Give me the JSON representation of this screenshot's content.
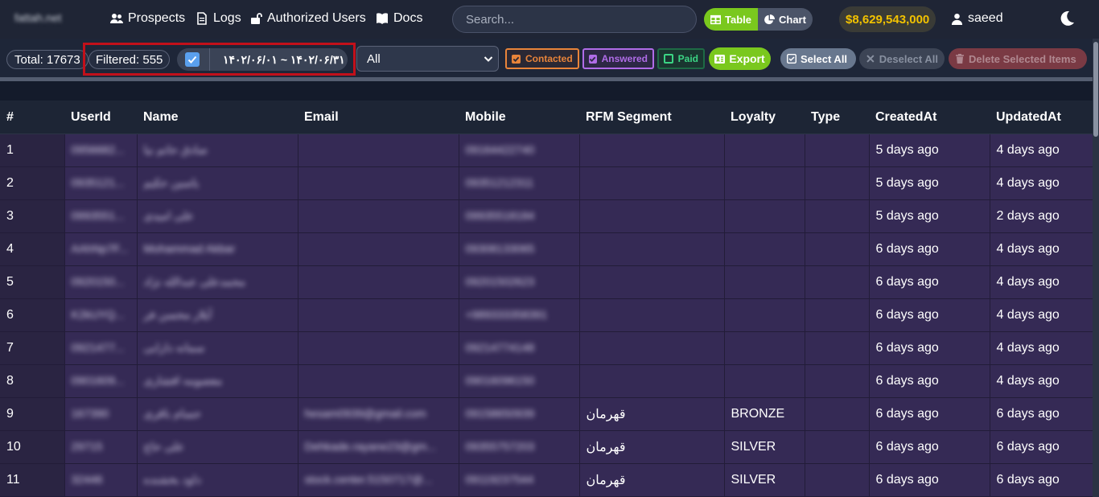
{
  "nav": {
    "brand": "fattah.net",
    "links": [
      {
        "label": "Prospects",
        "icon": "users-icon"
      },
      {
        "label": "Logs",
        "icon": "document-icon"
      },
      {
        "label": "Authorized Users",
        "icon": "unlock-icon"
      },
      {
        "label": "Docs",
        "icon": "book-icon"
      }
    ],
    "search_placeholder": "Search...",
    "view_table": "Table",
    "view_chart": "Chart",
    "balance": "$8,629,543,000",
    "username": "saeed"
  },
  "toolbar": {
    "total": "Total: 17673",
    "filtered": "Filtered: 555",
    "date_range": "۱۴۰۲/۰۶/۰۱ ~ ۱۴۰۲/۰۶/۳۱",
    "select_value": "All",
    "contacted": "Contacted",
    "answered": "Answered",
    "paid": "Paid",
    "export": "Export",
    "select_all": "Select All",
    "deselect_all": "Deselect All",
    "delete_selected": "Delete Selected Items"
  },
  "colors": {
    "accent_green": "#7ac81e",
    "balance_gold": "#f2c200",
    "contacted": "#e8843a",
    "answered": "#b06ce8",
    "paid": "#3bd484",
    "row_bg": "#352a55",
    "highlight_box": "#c2101a"
  },
  "table": {
    "headers": [
      "#",
      "UserId",
      "Name",
      "Email",
      "Mobile",
      "RFM Segment",
      "Loyalty",
      "Type",
      "CreatedAt",
      "UpdatedAt"
    ],
    "rows": [
      {
        "n": "1",
        "userid": "0956682...",
        "name": "صادق حاتم نیا",
        "email": "",
        "mobile": "09164422740",
        "rfm": "",
        "loyalty": "",
        "type": "",
        "created": "5 days ago",
        "updated": "4 days ago"
      },
      {
        "n": "2",
        "userid": "0935121...",
        "name": "یاسین حکیم",
        "email": "",
        "mobile": "09351212311",
        "rfm": "",
        "loyalty": "",
        "type": "",
        "created": "5 days ago",
        "updated": "4 days ago"
      },
      {
        "n": "3",
        "userid": "0993551...",
        "name": "علی امیدی",
        "email": "",
        "mobile": "09935518184",
        "rfm": "",
        "loyalty": "",
        "type": "",
        "created": "5 days ago",
        "updated": "2 days ago"
      },
      {
        "n": "4",
        "userid": "AAhNp7F...",
        "name": "Mohammad Akbar",
        "email": "",
        "mobile": "09308133065",
        "rfm": "",
        "loyalty": "",
        "type": "",
        "created": "6 days ago",
        "updated": "4 days ago"
      },
      {
        "n": "5",
        "userid": "0920150...",
        "name": "محمدعلی عبدالله نژاد",
        "email": "",
        "mobile": "09201502623",
        "rfm": "",
        "loyalty": "",
        "type": "",
        "created": "6 days ago",
        "updated": "4 days ago"
      },
      {
        "n": "6",
        "userid": "K2kUYQ...",
        "name": "آیلار محسن فر",
        "email": "",
        "mobile": "+989333358391",
        "rfm": "",
        "loyalty": "",
        "type": "",
        "created": "6 days ago",
        "updated": "4 days ago"
      },
      {
        "n": "7",
        "userid": "0921477...",
        "name": "سمانه دارابی",
        "email": "",
        "mobile": "09214774148",
        "rfm": "",
        "loyalty": "",
        "type": "",
        "created": "6 days ago",
        "updated": "4 days ago"
      },
      {
        "n": "8",
        "userid": "0901609...",
        "name": "معصومه افشاری",
        "email": "",
        "mobile": "09016096150",
        "rfm": "",
        "loyalty": "",
        "type": "",
        "created": "6 days ago",
        "updated": "4 days ago"
      },
      {
        "n": "9",
        "userid": "167390",
        "name": "حسام باقری",
        "email": "hesam0939@gmail.com",
        "mobile": "09158650939",
        "rfm": "قهرمان",
        "loyalty": "BRONZE",
        "type": "",
        "created": "6 days ago",
        "updated": "6 days ago"
      },
      {
        "n": "10",
        "userid": "29715",
        "name": "علی حاج",
        "email": "Dehkade.rayane23@gm...",
        "mobile": "09355757203",
        "rfm": "قهرمان",
        "loyalty": "SILVER",
        "type": "",
        "created": "6 days ago",
        "updated": "6 days ago"
      },
      {
        "n": "11",
        "userid": "32446",
        "name": "داود بخشنده",
        "email": "stock.center.5150717@...",
        "mobile": "09119237544",
        "rfm": "قهرمان",
        "loyalty": "SILVER",
        "type": "",
        "created": "6 days ago",
        "updated": "6 days ago"
      }
    ]
  }
}
